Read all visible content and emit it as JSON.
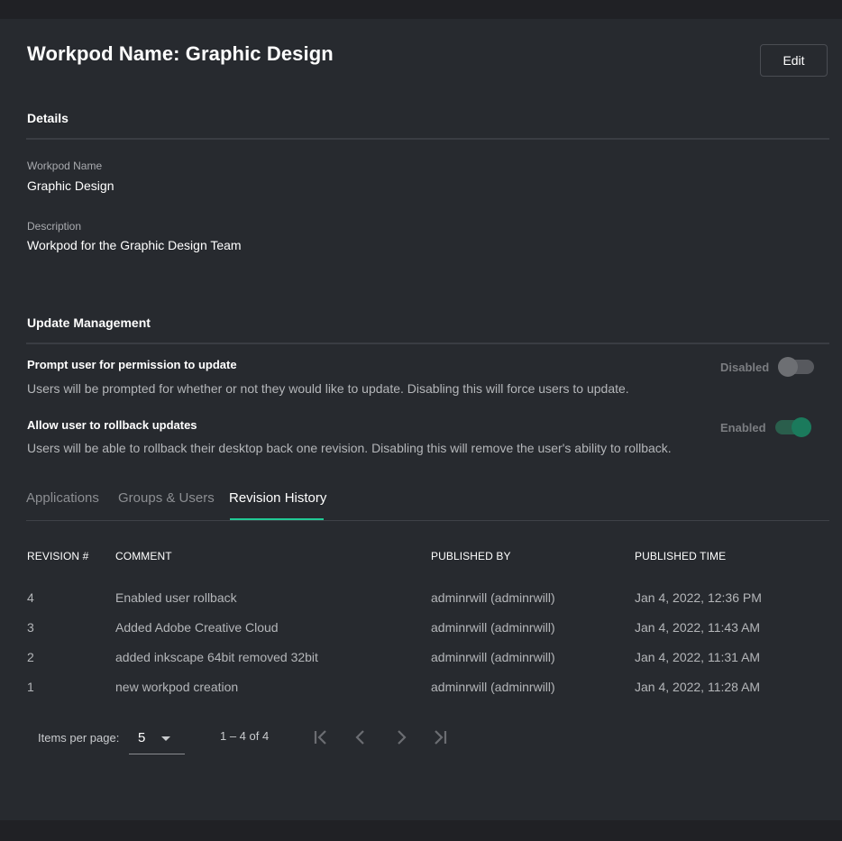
{
  "header": {
    "title": "Workpod Name: Graphic Design",
    "edit_label": "Edit"
  },
  "details": {
    "section_title": "Details",
    "workpod_name_label": "Workpod Name",
    "workpod_name_value": "Graphic Design",
    "description_label": "Description",
    "description_value": "Workpod for the Graphic Design Team"
  },
  "update_management": {
    "section_title": "Update Management",
    "settings": [
      {
        "title": "Prompt user for permission to update",
        "description": "Users will be prompted for whether or not they would like to update. Disabling this will force users to update.",
        "state_label": "Disabled",
        "enabled": false
      },
      {
        "title": "Allow user to rollback updates",
        "description": "Users will be able to rollback their desktop back one revision. Disabling this will remove the user's ability to rollback.",
        "state_label": "Enabled",
        "enabled": true
      }
    ]
  },
  "tabs": [
    {
      "label": "Applications",
      "active": false
    },
    {
      "label": "Groups & Users",
      "active": false
    },
    {
      "label": "Revision History",
      "active": true
    }
  ],
  "colors": {
    "accent": "#21c995",
    "toggle_on": "#1b7a5c",
    "background": "#272a2f"
  },
  "revision_table": {
    "columns": [
      "REVISION #",
      "COMMENT",
      "PUBLISHED BY",
      "PUBLISHED TIME"
    ],
    "rows": [
      {
        "revision": "4",
        "comment": "Enabled user rollback",
        "published_by": "adminrwill (adminrwill)",
        "published_time": "Jan 4, 2022, 12:36 PM"
      },
      {
        "revision": "3",
        "comment": "Added Adobe Creative Cloud",
        "published_by": "adminrwill (adminrwill)",
        "published_time": "Jan 4, 2022, 11:43 AM"
      },
      {
        "revision": "2",
        "comment": "added inkscape 64bit removed 32bit",
        "published_by": "adminrwill (adminrwill)",
        "published_time": "Jan 4, 2022, 11:31 AM"
      },
      {
        "revision": "1",
        "comment": "new workpod creation",
        "published_by": "adminrwill (adminrwill)",
        "published_time": "Jan 4, 2022, 11:28 AM"
      }
    ]
  },
  "paginator": {
    "items_per_page_label": "Items per page:",
    "items_per_page_value": "5",
    "range_label": "1 – 4 of 4",
    "icons": [
      "first-page-icon",
      "previous-page-icon",
      "next-page-icon",
      "last-page-icon"
    ]
  }
}
